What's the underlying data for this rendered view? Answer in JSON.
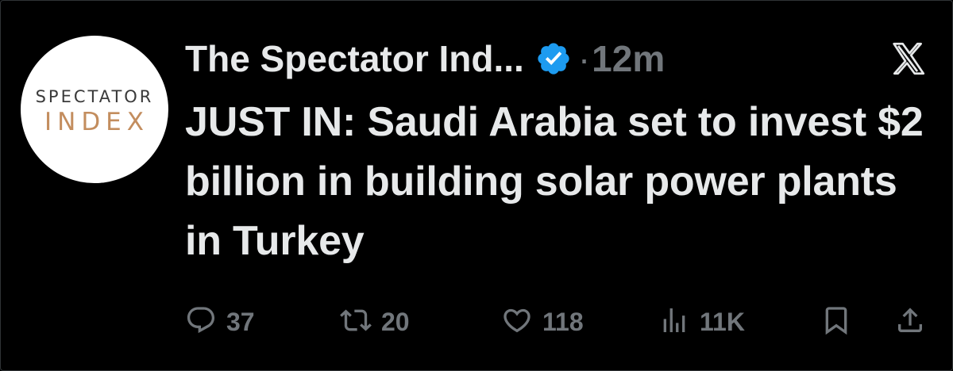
{
  "avatar": {
    "line1": "SPECTATOR",
    "line2": "INDEX"
  },
  "header": {
    "display_name": "The Spectator Ind...",
    "separator": "·",
    "timestamp": "12m"
  },
  "tweet": {
    "text": "JUST IN: Saudi Arabia set to invest $2 billion in building solar power plants in Turkey"
  },
  "actions": {
    "replies": "37",
    "reposts": "20",
    "likes": "118",
    "views": "11K"
  },
  "colors": {
    "background": "#000000",
    "text_primary": "#e7e9ea",
    "text_secondary": "#71767b",
    "verified_blue": "#1d9bf0",
    "logo_accent": "#c38d5e"
  },
  "icons": {
    "verified": "verified-badge-icon",
    "brand": "x-logo-icon",
    "reply": "reply-icon",
    "repost": "repost-icon",
    "like": "heart-icon",
    "views": "views-bar-chart-icon",
    "bookmark": "bookmark-icon",
    "share": "share-icon"
  }
}
